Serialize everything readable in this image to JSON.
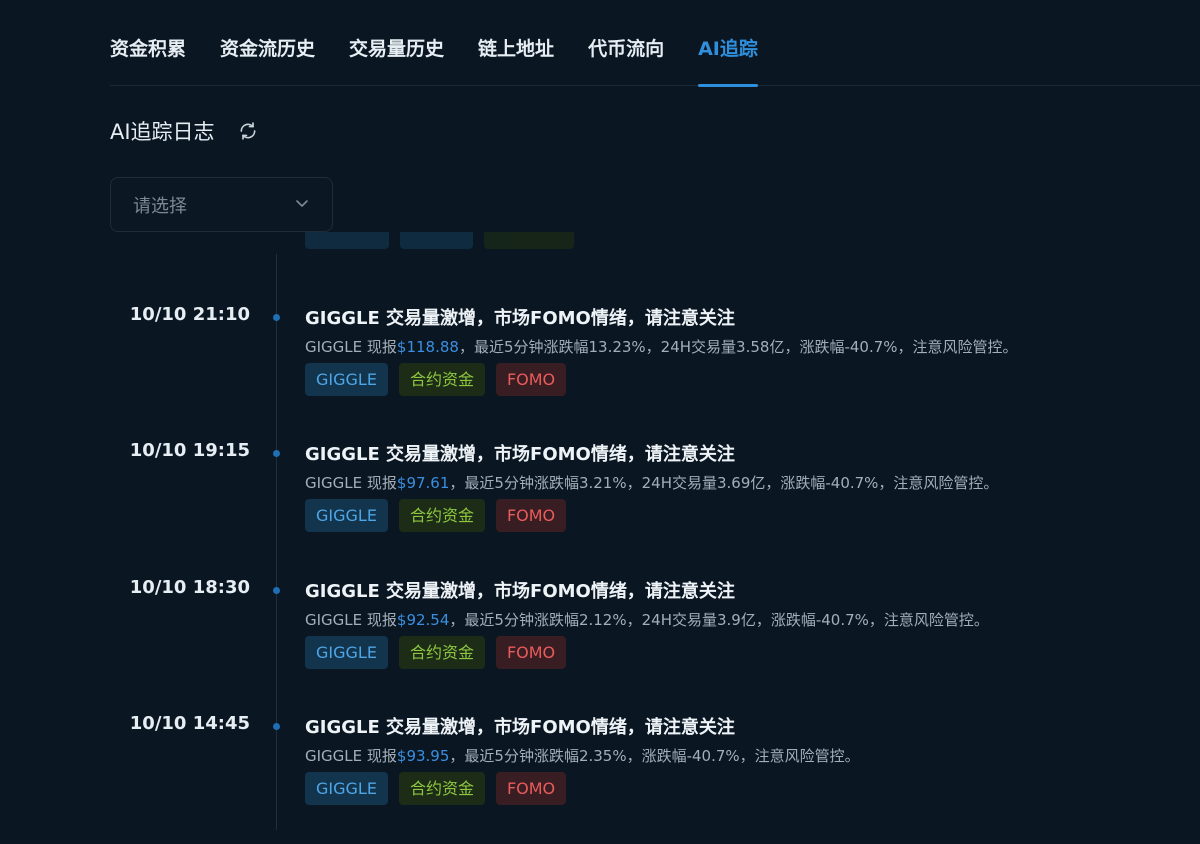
{
  "tabs": [
    {
      "label": "资金积累",
      "active": false
    },
    {
      "label": "资金流历史",
      "active": false
    },
    {
      "label": "交易量历史",
      "active": false
    },
    {
      "label": "链上地址",
      "active": false
    },
    {
      "label": "代币流向",
      "active": false
    },
    {
      "label": "AI追踪",
      "active": true
    }
  ],
  "section": {
    "title": "AI追踪日志",
    "refresh_icon": "refresh-icon"
  },
  "select": {
    "placeholder": "请选择",
    "icon": "chevron-down-icon"
  },
  "entries": [
    {
      "time": "10/10 21:10",
      "title": "GIGGLE 交易量激增，市场FOMO情绪，请注意关注",
      "desc_prefix": "GIGGLE 现报",
      "price": "$118.88",
      "desc_suffix": "，最近5分钟涨跌幅13.23%，24H交易量3.58亿，涨跌幅-40.7%，注意风险管控。",
      "tags": [
        "GIGGLE",
        "合约资金",
        "FOMO"
      ]
    },
    {
      "time": "10/10 19:15",
      "title": "GIGGLE 交易量激增，市场FOMO情绪，请注意关注",
      "desc_prefix": "GIGGLE 现报",
      "price": "$97.61",
      "desc_suffix": "，最近5分钟涨跌幅3.21%，24H交易量3.69亿，涨跌幅-40.7%，注意风险管控。",
      "tags": [
        "GIGGLE",
        "合约资金",
        "FOMO"
      ]
    },
    {
      "time": "10/10 18:30",
      "title": "GIGGLE 交易量激增，市场FOMO情绪，请注意关注",
      "desc_prefix": "GIGGLE 现报",
      "price": "$92.54",
      "desc_suffix": "，最近5分钟涨跌幅2.12%，24H交易量3.9亿，涨跌幅-40.7%，注意风险管控。",
      "tags": [
        "GIGGLE",
        "合约资金",
        "FOMO"
      ]
    },
    {
      "time": "10/10 14:45",
      "title": "GIGGLE 交易量激增，市场FOMO情绪，请注意关注",
      "desc_prefix": "GIGGLE 现报",
      "price": "$93.95",
      "desc_suffix": "，最近5分钟涨跌幅2.35%，涨跌幅-40.7%，注意风险管控。",
      "tags": [
        "GIGGLE",
        "合约资金",
        "FOMO"
      ]
    }
  ],
  "colors": {
    "background": "#0a1621",
    "accent": "#2f8fdc",
    "tag_token": "#4ea6e6",
    "tag_fund": "#8dc63f",
    "tag_fomo": "#ea5b5b"
  }
}
